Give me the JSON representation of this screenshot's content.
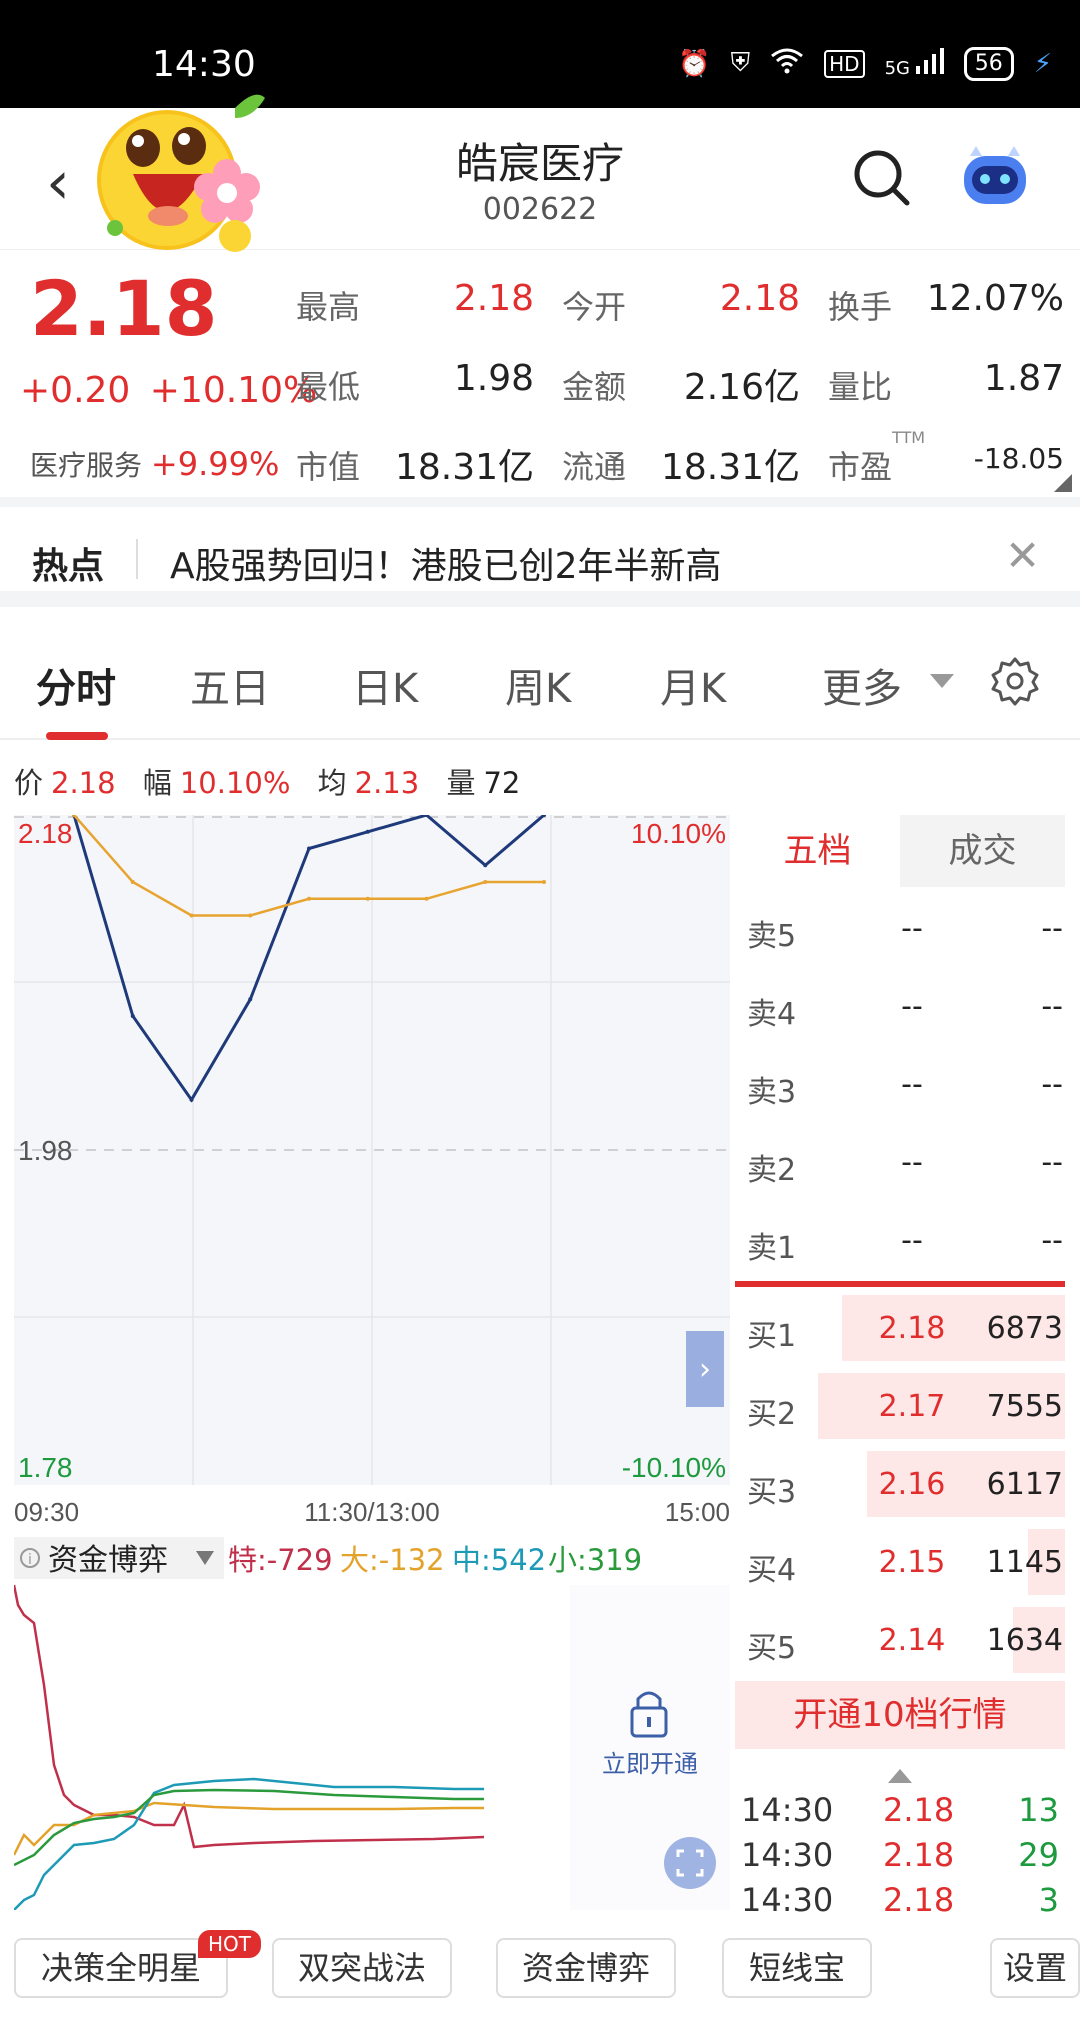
{
  "status_bar": {
    "time": "14:30",
    "battery": "56",
    "network": "5G",
    "hd": "HD"
  },
  "header": {
    "title": "皓宸医疗",
    "code": "002622"
  },
  "quote": {
    "price": "2.18",
    "change": "+0.20",
    "change_pct": "+10.10%",
    "sector_name": "医疗服务",
    "sector_pct": "+9.99%",
    "stats": [
      {
        "label": "最高",
        "value": "2.18",
        "color": "red"
      },
      {
        "label": "今开",
        "value": "2.18",
        "color": "red"
      },
      {
        "label": "换手",
        "value": "12.07%",
        "color": "blk"
      },
      {
        "label": "最低",
        "value": "1.98",
        "color": "blk"
      },
      {
        "label": "金额",
        "value": "2.16亿",
        "color": "blk"
      },
      {
        "label": "量比",
        "value": "1.87",
        "color": "blk"
      },
      {
        "label": "市值",
        "value": "18.31亿",
        "color": "blk"
      },
      {
        "label": "流通",
        "value": "18.31亿",
        "color": "blk"
      },
      {
        "label": "市盈",
        "value": "-18.05",
        "color": "blk"
      }
    ],
    "ttm": "TTM"
  },
  "hot": {
    "label": "热点",
    "text": "A股强势回归！港股已创2年半新高"
  },
  "tabs": [
    "分时",
    "五日",
    "日K",
    "周K",
    "月K",
    "更多"
  ],
  "infobar": {
    "price_label": "价",
    "price": "2.18",
    "amp_label": "幅",
    "amp": "10.10%",
    "avg_label": "均",
    "avg": "2.13",
    "vol_label": "量",
    "vol": "72"
  },
  "chart": {
    "y_top": "2.18",
    "y_mid": "1.98",
    "y_bot": "1.78",
    "pct_top": "10.10%",
    "pct_bot": "-10.10%",
    "x_labels": [
      "09:30",
      "11:30/13:00",
      "15:00"
    ],
    "fund_title": "资金博弈",
    "fund_legend": [
      {
        "label": "特:-729",
        "color": "#c0304a"
      },
      {
        "label": "大:-132",
        "color": "#e3a22a"
      },
      {
        "label": "中:542",
        "color": "#1c9a8a"
      },
      {
        "label": "小:319",
        "color": "#2a9a3d"
      }
    ],
    "unlock_label": "立即开通"
  },
  "chart_data": {
    "type": "line",
    "title": "",
    "x": [
      "09:30",
      "10:00",
      "10:30",
      "11:00",
      "11:30/13:00",
      "13:30",
      "14:00",
      "14:30",
      "15:00"
    ],
    "series": [
      {
        "name": "价",
        "values": [
          2.18,
          2.06,
          2.01,
          2.07,
          2.16,
          2.17,
          2.18,
          2.15,
          2.18
        ],
        "color": "#1f3a7a"
      },
      {
        "name": "均",
        "values": [
          2.18,
          2.14,
          2.12,
          2.12,
          2.13,
          2.13,
          2.13,
          2.14,
          2.14
        ],
        "color": "#e8a431"
      }
    ],
    "ylim": [
      1.78,
      2.18
    ]
  },
  "orderbook": {
    "tabs": [
      "五档",
      "成交"
    ],
    "sells": [
      {
        "name": "卖5",
        "price": "--",
        "qty": "--"
      },
      {
        "name": "卖4",
        "price": "--",
        "qty": "--"
      },
      {
        "name": "卖3",
        "price": "--",
        "qty": "--"
      },
      {
        "name": "卖2",
        "price": "--",
        "qty": "--"
      },
      {
        "name": "卖1",
        "price": "--",
        "qty": "--"
      }
    ],
    "buys": [
      {
        "name": "买1",
        "price": "2.18",
        "qty": "6873",
        "fill": 0.9
      },
      {
        "name": "买2",
        "price": "2.17",
        "qty": "7555",
        "fill": 1.0
      },
      {
        "name": "买3",
        "price": "2.16",
        "qty": "6117",
        "fill": 0.8
      },
      {
        "name": "买4",
        "price": "2.15",
        "qty": "1145",
        "fill": 0.15
      },
      {
        "name": "买5",
        "price": "2.14",
        "qty": "1634",
        "fill": 0.21
      }
    ],
    "open10": "开通10档行情",
    "ticks": [
      {
        "time": "14:30",
        "price": "2.18",
        "vol": "13"
      },
      {
        "time": "14:30",
        "price": "2.18",
        "vol": "29"
      },
      {
        "time": "14:30",
        "price": "2.18",
        "vol": "3"
      }
    ]
  },
  "bottom_buttons": {
    "b1": "决策全明星",
    "hot": "HOT",
    "b2": "双突战法",
    "b3": "资金博弈",
    "b4": "短线宝",
    "b5": "设置"
  }
}
